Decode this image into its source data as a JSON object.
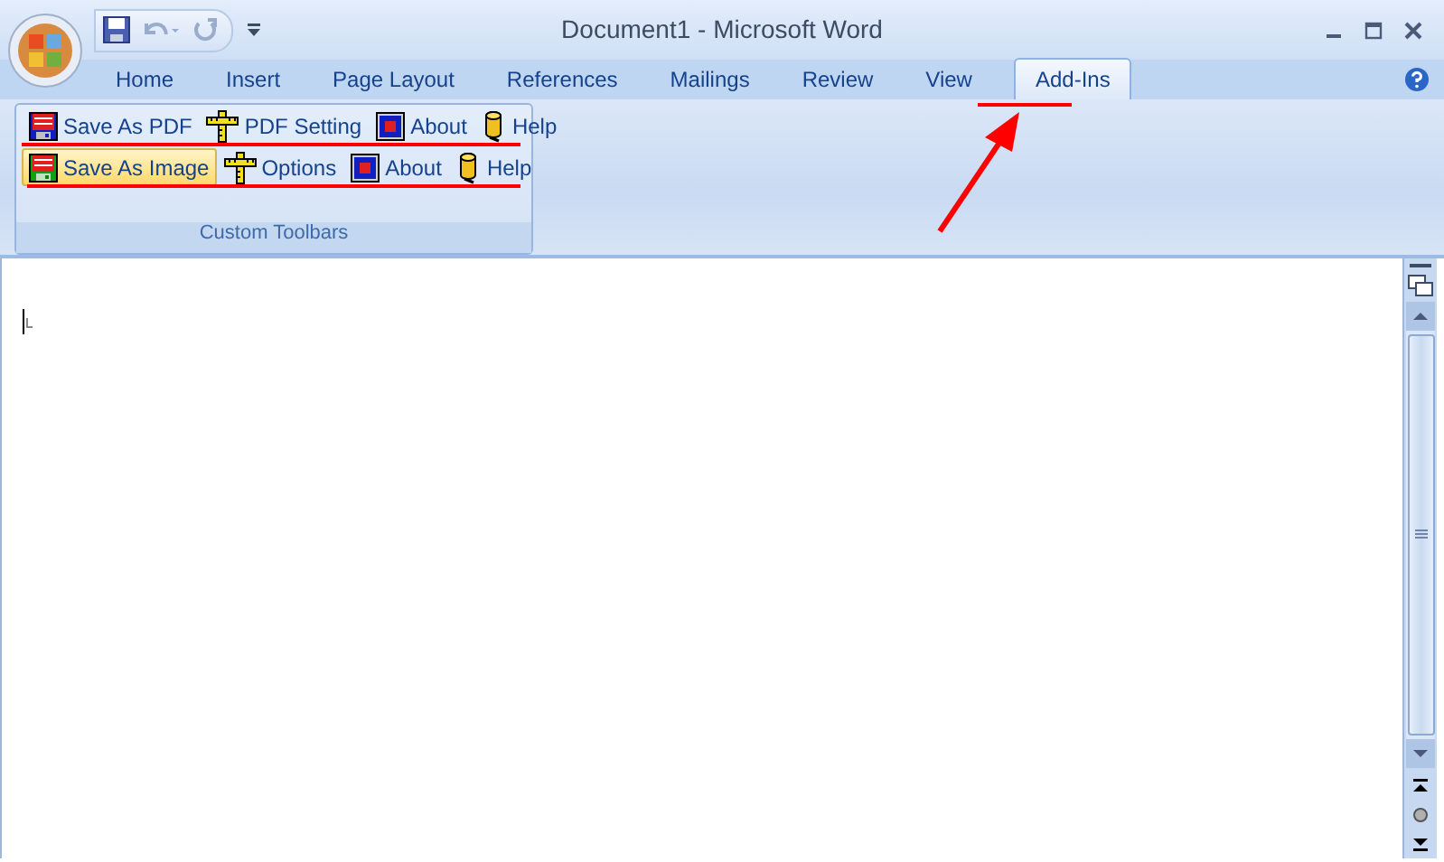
{
  "window": {
    "title": "Document1 - Microsoft Word"
  },
  "tabs": [
    {
      "label": "Home",
      "selected": false
    },
    {
      "label": "Insert",
      "selected": false
    },
    {
      "label": "Page Layout",
      "selected": false
    },
    {
      "label": "References",
      "selected": false
    },
    {
      "label": "Mailings",
      "selected": false
    },
    {
      "label": "Review",
      "selected": false
    },
    {
      "label": "View",
      "selected": false
    },
    {
      "label": "Add-Ins",
      "selected": true
    }
  ],
  "ribbon": {
    "group_label": "Custom Toolbars",
    "toolbars": [
      [
        {
          "label": "Save As PDF",
          "kind": "save-pdf",
          "highlighted": false
        },
        {
          "label": "PDF Setting",
          "kind": "setting",
          "highlighted": false
        },
        {
          "label": "About",
          "kind": "about",
          "highlighted": false
        },
        {
          "label": "Help",
          "kind": "help",
          "highlighted": false
        }
      ],
      [
        {
          "label": "Save As Image",
          "kind": "save-image",
          "highlighted": true
        },
        {
          "label": "Options",
          "kind": "setting",
          "highlighted": false
        },
        {
          "label": "About",
          "kind": "about",
          "highlighted": false
        },
        {
          "label": "Help",
          "kind": "help",
          "highlighted": false
        }
      ]
    ]
  }
}
